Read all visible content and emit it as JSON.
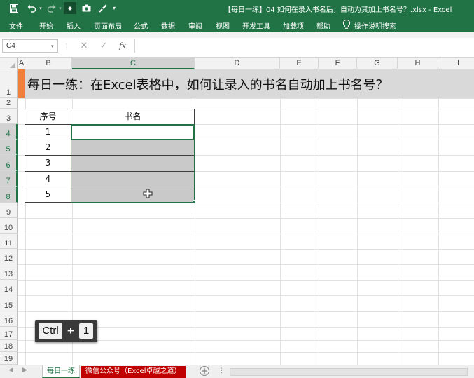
{
  "window": {
    "title": "【每日一练】04 如何在录入书名后，自动为其加上书名号？.xlsx  -  Excel"
  },
  "quick_access": {
    "icons": [
      "save-icon",
      "undo-icon",
      "redo-icon",
      "record-icon",
      "camera-icon",
      "brush-icon",
      "customize-qat-icon"
    ]
  },
  "ribbon": {
    "tabs": [
      "文件",
      "开始",
      "插入",
      "页面布局",
      "公式",
      "数据",
      "审阅",
      "视图",
      "开发工具",
      "加载项",
      "帮助"
    ],
    "tell_me": "操作说明搜索"
  },
  "formula_bar": {
    "name_box": "C4",
    "formula": ""
  },
  "grid": {
    "columns": [
      "A",
      "B",
      "C",
      "D",
      "E",
      "F",
      "G",
      "H",
      "I"
    ],
    "rows": [
      "1",
      "2",
      "3",
      "4",
      "5",
      "6",
      "7",
      "8",
      "9",
      "10",
      "11",
      "12",
      "13",
      "14",
      "15",
      "16",
      "17",
      "18",
      "19"
    ],
    "selected_column": "C",
    "selected_rows": [
      "4",
      "5",
      "6",
      "7",
      "8"
    ]
  },
  "banner": {
    "text": "每日一练：在Excel表格中，如何让录入的书名自动加上书名号？",
    "accent_color": "#f07f3c"
  },
  "table": {
    "headers": [
      "序号",
      "书名"
    ],
    "rows": [
      {
        "no": "1",
        "name": ""
      },
      {
        "no": "2",
        "name": ""
      },
      {
        "no": "3",
        "name": ""
      },
      {
        "no": "4",
        "name": ""
      },
      {
        "no": "5",
        "name": ""
      }
    ]
  },
  "keystroke": {
    "key1": "Ctrl",
    "plus": "+",
    "key2": "1"
  },
  "sheet_tabs": [
    {
      "label": "每日一练",
      "active": true
    },
    {
      "label": "微信公众号（Excel卓越之道）",
      "active": false,
      "color": "#c00000"
    }
  ],
  "colors": {
    "excel_green": "#217346",
    "banner_gray": "#d9d9d9",
    "selection_gray": "#c9c9c9"
  }
}
